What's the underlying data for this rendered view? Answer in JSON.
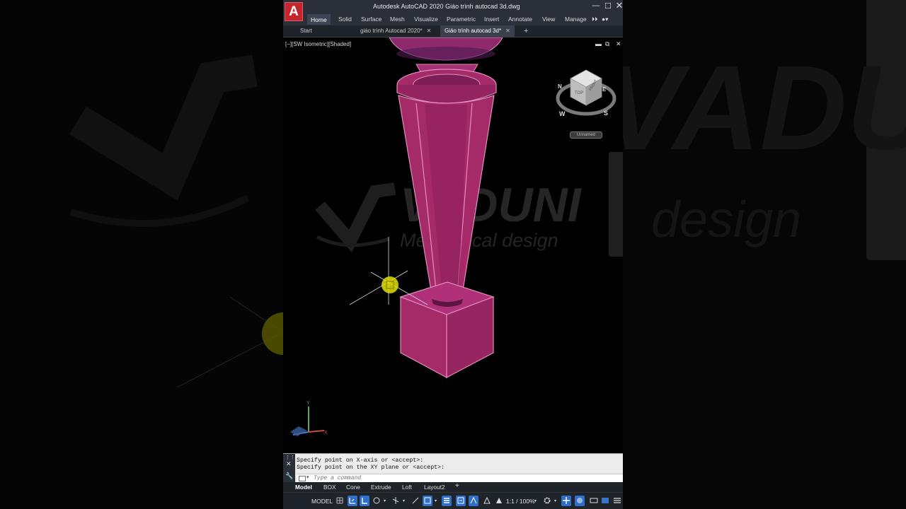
{
  "app": {
    "logo": "A",
    "title": "Autodesk AutoCAD 2020    Giáo trình autocad 3d.dwg"
  },
  "ribbon": {
    "tabs": [
      "Home",
      "Solid",
      "Surface",
      "Mesh",
      "Visualize",
      "Parametric",
      "Insert",
      "Annotate",
      "View",
      "Manage"
    ],
    "active": "Home"
  },
  "doc_tabs": {
    "start": "Start",
    "tab1": "giáo trình Autocad 2020*",
    "tab2": "Giáo trình autocad 3d*",
    "close": "✕",
    "new": "+"
  },
  "viewport": {
    "label": "[−][SW Isometric][Shaded]",
    "viewcube": {
      "face_top": "TOP",
      "face_front": "FRONT",
      "compass": [
        "N",
        "E",
        "S",
        "W"
      ],
      "ucs_name": "Unnamed"
    },
    "ucs_icon": {
      "x": "X",
      "y": "Y"
    }
  },
  "watermark": {
    "brand": "VADUNI",
    "tagline": "Mechanical design"
  },
  "background_watermark": {
    "brand": "VADUNI",
    "tagline": "design"
  },
  "command": {
    "history": [
      "Specify point on X-axis or <accept>:",
      "Specify point on the XY plane or <accept>:"
    ],
    "placeholder": "Type a command"
  },
  "layout_tabs": [
    "Model",
    "BOX",
    "Cone",
    "Extrude",
    "Loft",
    "Layout2"
  ],
  "layout_add": "+",
  "status_bar": {
    "model": "MODEL",
    "scale": "1:1 / 100%"
  },
  "colors": {
    "solid_fill": "#a42a68",
    "solid_edge": "#e48cc0",
    "cursor_marker": "#e3e000",
    "ribbon_bg": "#2b2f37",
    "status_on": "#2f6fc7"
  }
}
